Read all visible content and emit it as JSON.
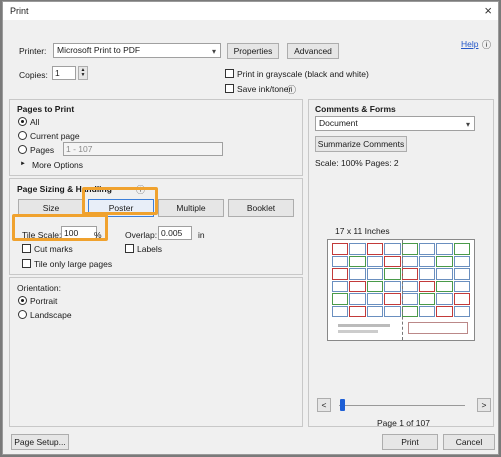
{
  "title": "Print",
  "close_glyph": "×",
  "printer": {
    "label": "Printer:",
    "value": "Microsoft Print to PDF",
    "properties": "Properties",
    "advanced": "Advanced",
    "help": "Help",
    "help_icon": "ⓘ"
  },
  "copies": {
    "label": "Copies:",
    "value": "1"
  },
  "options": {
    "grayscale": "Print in grayscale (black and white)",
    "save_ink": "Save ink/toner",
    "info_icon": "ⓘ"
  },
  "pages_to_print": {
    "heading": "Pages to Print",
    "all": "All",
    "current": "Current page",
    "pages": "Pages",
    "pages_value": "1 - 107",
    "more_options": "More Options",
    "expand_glyph": "►"
  },
  "sizing": {
    "heading": "Page Sizing & Handling",
    "info_icon": "ⓘ",
    "size": "Size",
    "poster": "Poster",
    "multiple": "Multiple",
    "booklet": "Booklet",
    "tile_scale_label": "Tile Scale:",
    "tile_scale_value": "100",
    "tile_scale_unit": "%",
    "overlap_label": "Overlap:",
    "overlap_value": "0.005",
    "overlap_unit": "in",
    "cut_marks": "Cut marks",
    "labels": "Labels",
    "tile_large": "Tile only large pages"
  },
  "orientation": {
    "heading": "Orientation:",
    "portrait": "Portrait",
    "landscape": "Landscape"
  },
  "comments": {
    "heading": "Comments & Forms",
    "value": "Document",
    "summarize": "Summarize Comments",
    "scale_line": "Scale: 100% Pages: 2"
  },
  "preview": {
    "size_label": "17 x 11 Inches",
    "prev": "<",
    "next": ">",
    "page_info": "Page 1 of 107",
    "slider_position": 0.01
  },
  "footer": {
    "page_setup": "Page Setup...",
    "print": "Print",
    "cancel": "Cancel"
  },
  "colors": {
    "highlight": "#f0a22e",
    "link": "#2457c8",
    "slider_thumb": "#1e5fd6"
  }
}
